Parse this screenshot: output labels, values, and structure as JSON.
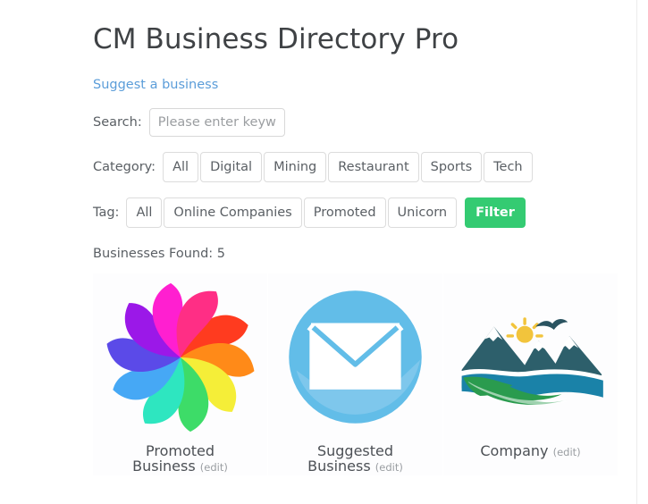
{
  "header": {
    "title": "CM Business Directory Pro",
    "suggest_link": "Suggest a business"
  },
  "filters": {
    "search": {
      "label": "Search:",
      "placeholder": "Please enter keywords",
      "value": ""
    },
    "category": {
      "label": "Category:",
      "options": [
        "All",
        "Digital",
        "Mining",
        "Restaurant",
        "Sports",
        "Tech"
      ]
    },
    "tag": {
      "label": "Tag:",
      "options": [
        "All",
        "Online Companies",
        "Promoted",
        "Unicorn"
      ]
    },
    "filter_button": {
      "label": "Filter",
      "color": "#34cb72"
    }
  },
  "results": {
    "found_text": "Businesses Found: 5",
    "count": 5,
    "items": [
      {
        "name_line1": "Promoted",
        "name_line2": "Business",
        "edit_label": "(edit)",
        "logo": "color-pinwheel-icon"
      },
      {
        "name_line1": "Suggested",
        "name_line2": "Business",
        "edit_label": "(edit)",
        "logo": "blue-envelope-circle-icon"
      },
      {
        "name_line1": "Company",
        "name_line2": "",
        "edit_label": "(edit)",
        "logo": "mountain-lake-icon"
      }
    ]
  },
  "colors": {
    "link": "#5b9dd9",
    "accent_green": "#34cb72",
    "text": "#5a5f64",
    "title": "#3f4245"
  }
}
